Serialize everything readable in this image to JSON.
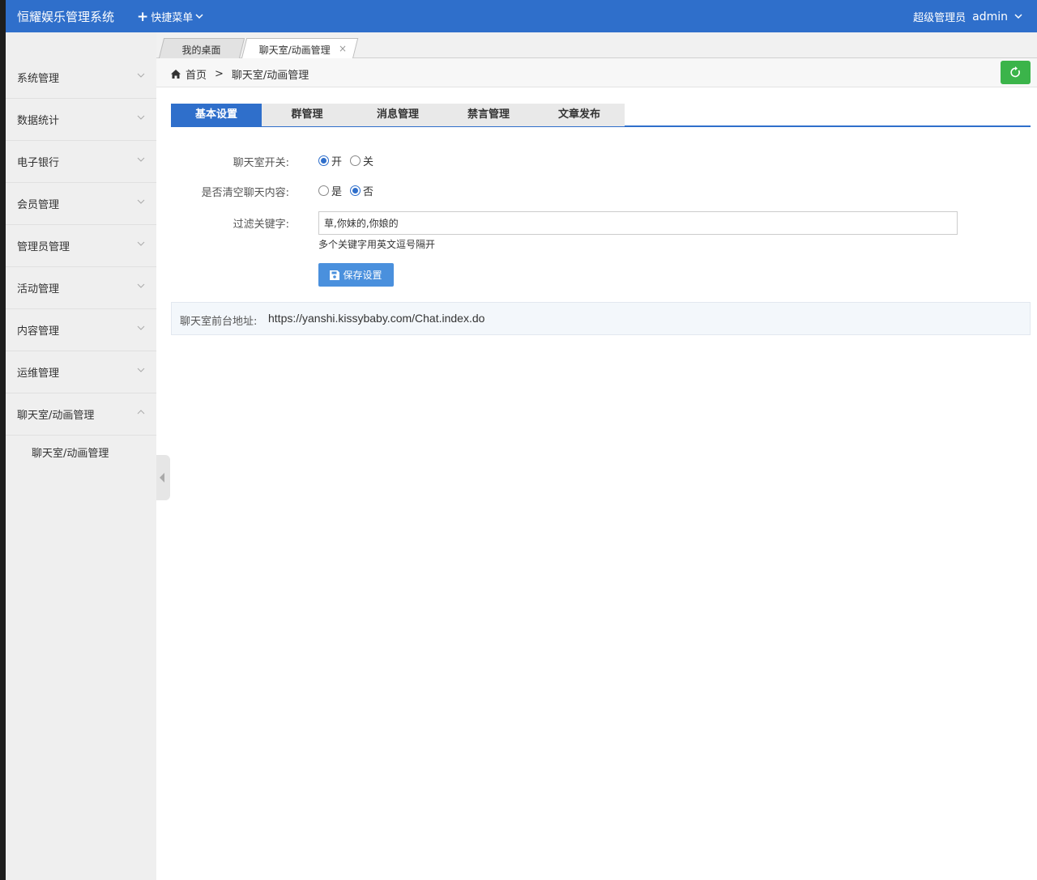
{
  "header": {
    "app_title": "恒耀娱乐管理系统",
    "quick_menu": "快捷菜单",
    "role": "超级管理员",
    "username": "admin"
  },
  "sidebar": {
    "items": [
      {
        "label": "系统管理"
      },
      {
        "label": "数据统计"
      },
      {
        "label": "电子银行"
      },
      {
        "label": "会员管理"
      },
      {
        "label": "管理员管理"
      },
      {
        "label": "活动管理"
      },
      {
        "label": "内容管理"
      },
      {
        "label": "运维管理"
      },
      {
        "label": "聊天室/动画管理",
        "expanded": true
      }
    ],
    "sub_item": "聊天室/动画管理"
  },
  "page_tabs": [
    {
      "label": "我的桌面"
    },
    {
      "label": "聊天室/动画管理",
      "close": "×",
      "active": true
    }
  ],
  "breadcrumb": {
    "home": "首页",
    "separator": ">",
    "current": "聊天室/动画管理"
  },
  "content_tabs": [
    {
      "label": "基本设置",
      "active": true
    },
    {
      "label": "群管理"
    },
    {
      "label": "消息管理"
    },
    {
      "label": "禁言管理"
    },
    {
      "label": "文章发布"
    }
  ],
  "form": {
    "chat_switch": {
      "label": "聊天室开关:",
      "options": [
        "开",
        "关"
      ],
      "selected": "开"
    },
    "clear_content": {
      "label": "是否清空聊天内容:",
      "options": [
        "是",
        "否"
      ],
      "selected": "否"
    },
    "keywords": {
      "label": "过滤关键字:",
      "value": "草,你妹的,你娘的",
      "hint": "多个关键字用英文逗号隔开"
    },
    "save_label": "保存设置"
  },
  "address": {
    "label": "聊天室前台地址:",
    "url": "https://yanshi.kissybaby.com/Chat.index.do"
  },
  "colors": {
    "header_bg": "#2f6fcb",
    "accent": "#2f6fcb",
    "refresh_button": "#3bb44a",
    "save_button": "#4a90dd"
  },
  "icons": [
    "plus-icon",
    "chevron-down-icon",
    "home-icon",
    "refresh-icon",
    "save-icon",
    "close-icon",
    "collapse-sidebar-icon"
  ]
}
